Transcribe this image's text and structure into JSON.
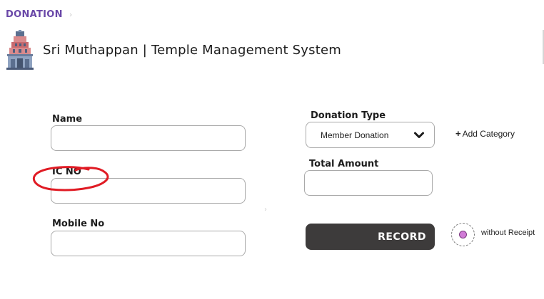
{
  "breadcrumb": {
    "label": "DONATION",
    "chevron_icon": "chevron-right-icon"
  },
  "header": {
    "logo_icon": "temple-gopuram-icon",
    "title": "Sri Muthappan |  Temple Management System"
  },
  "form": {
    "name": {
      "label": "Name",
      "value": "",
      "placeholder": ""
    },
    "ic_no": {
      "label": "IC NO",
      "value": "",
      "placeholder": ""
    },
    "mobile_no": {
      "label": "Mobile No",
      "value": "",
      "placeholder": ""
    },
    "donation_type": {
      "label": "Donation Type",
      "selected": "Member Donation",
      "chevron_icon": "chevron-down-icon"
    },
    "add_category": {
      "icon": "plus-icon",
      "icon_glyph": "+",
      "label": "Add Category"
    },
    "total_amount": {
      "label": "Total Amount",
      "value": "",
      "placeholder": ""
    },
    "record_button": {
      "label": "RECORD"
    },
    "without_receipt": {
      "label": "without Receipt",
      "selected": false
    }
  },
  "annotation": {
    "type": "hand-drawn-ellipse",
    "color": "#e01b24",
    "target": "IC NO"
  },
  "colors": {
    "brand_purple": "#6a48a8",
    "record_button_bg": "#3d3b3b",
    "radio_dot": "#d07bd6",
    "input_border": "#a9a9a9"
  }
}
